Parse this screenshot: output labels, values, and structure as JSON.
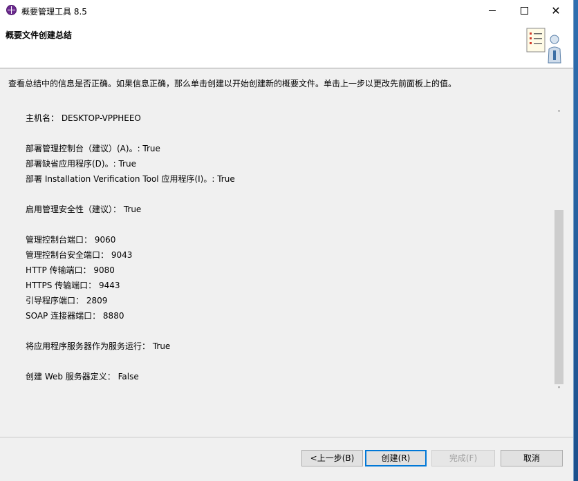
{
  "window": {
    "title": "概要管理工具 8.5",
    "controls": {
      "minimize": "—",
      "maximize": "□",
      "close": "✕"
    }
  },
  "header": {
    "title": "概要文件创建总结",
    "icon": "checklist-person-icon"
  },
  "instruction": "查看总结中的信息是否正确。如果信息正确，那么单击创建以开始创建新的概要文件。单击上一步以更改先前面板上的值。",
  "summary": {
    "lines": [
      "主机名： DESKTOP-VPPHEEO",
      "部署管理控制台（建议）(A)。: True",
      "部署缺省应用程序(D)。: True",
      "部署 Installation Verification Tool 应用程序(I)。: True",
      "启用管理安全性（建议）： True",
      "管理控制台端口： 9060",
      "管理控制台安全端口： 9043",
      "HTTP 传输端口： 9080",
      "HTTPS 传输端口： 9443",
      "引导程序端口： 2809",
      "SOAP 连接器端口： 8880",
      "将应用程序服务器作为服务运行： True",
      "创建 Web 服务器定义： False"
    ]
  },
  "scrollbar": {
    "position": 0.36,
    "up": "˄",
    "down": "˅"
  },
  "buttons": {
    "back": "<上一步(B)",
    "create": "创建(R)",
    "finish": "完成(F)",
    "cancel": "取消"
  },
  "colors": {
    "accent": "#0078d7",
    "app_icon": "#6b2a8f"
  }
}
